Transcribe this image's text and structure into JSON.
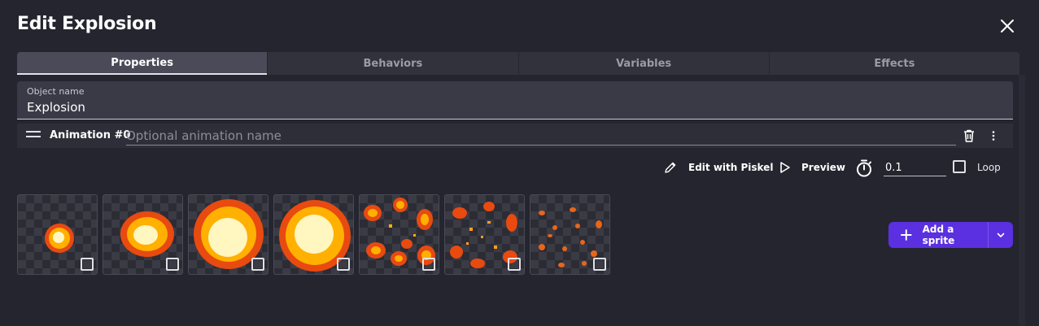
{
  "dialog": {
    "title": "Edit Explosion"
  },
  "tabs": [
    {
      "label": "Properties",
      "active": true
    },
    {
      "label": "Behaviors",
      "active": false
    },
    {
      "label": "Variables",
      "active": false
    },
    {
      "label": "Effects",
      "active": false
    }
  ],
  "object_name": {
    "label": "Object name",
    "value": "Explosion"
  },
  "animation": {
    "label": "Animation #0",
    "name_placeholder": "Optional animation name"
  },
  "toolbar": {
    "edit_label": "Edit with Piskel",
    "preview_label": "Preview",
    "duration_value": "0.1",
    "loop_label": "Loop",
    "loop_checked": false
  },
  "frames": [
    {
      "name": "frame-1",
      "selected": false
    },
    {
      "name": "frame-2",
      "selected": false
    },
    {
      "name": "frame-3",
      "selected": false
    },
    {
      "name": "frame-4",
      "selected": false
    },
    {
      "name": "frame-5",
      "selected": false
    },
    {
      "name": "frame-6",
      "selected": false
    },
    {
      "name": "frame-7",
      "selected": false
    }
  ],
  "add_sprite": {
    "label": "Add a sprite"
  },
  "colors": {
    "accent": "#5a30e0",
    "background": "#25252f",
    "fire_core": "#fff6c0",
    "fire_mid": "#ffb000",
    "fire_outer": "#e84a10"
  },
  "icons": [
    "close-icon",
    "drag-handle-icon",
    "trash-icon",
    "more-vert-icon",
    "pencil-icon",
    "play-icon",
    "timer-icon",
    "plus-icon",
    "chevron-down-icon"
  ]
}
